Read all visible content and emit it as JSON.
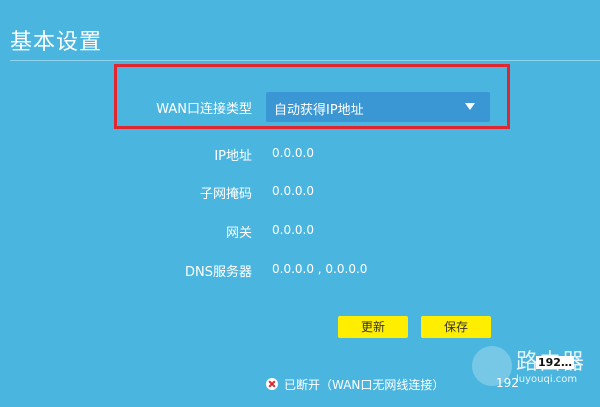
{
  "page": {
    "title": "基本设置"
  },
  "wan": {
    "label": "WAN口连接类型",
    "selected": "自动获得IP地址"
  },
  "fields": {
    "ip": {
      "label": "IP地址",
      "value": "0.0.0.0"
    },
    "mask": {
      "label": "子网掩码",
      "value": "0.0.0.0"
    },
    "gateway": {
      "label": "网关",
      "value": "0.0.0.0"
    },
    "dns": {
      "label": "DNS服务器",
      "value": "0.0.0.0 , 0.0.0.0"
    }
  },
  "buttons": {
    "refresh": "更新",
    "save": "保存"
  },
  "status": {
    "text": "已断开（WAN口无网线连接）",
    "ip_fragment": "192"
  },
  "watermark": {
    "text": "路由器",
    "url": "luyouqi.com",
    "badge": "192…"
  },
  "colors": {
    "background": "#4ab6df",
    "select": "#3b97d4",
    "button": "#ffee00",
    "highlight": "#e0262e"
  },
  "icons": {
    "dropdown": "caret-down-icon",
    "status": "disconnected-icon",
    "logo": "router-logo-icon"
  }
}
